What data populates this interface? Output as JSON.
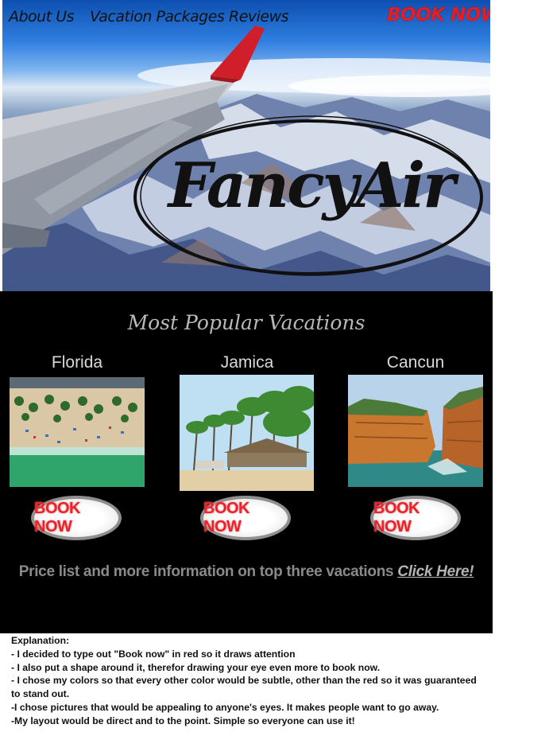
{
  "nav": {
    "about": "About Us",
    "packages": "Vacation Packages",
    "reviews": "Reviews",
    "book_now": "BOOK NOW"
  },
  "logo": {
    "text": "FancyAir"
  },
  "popular": {
    "title": "Most Popular Vacations",
    "destinations": [
      {
        "name": "Florida",
        "button": "BOOK NOW"
      },
      {
        "name": "Jamica",
        "button": "BOOK NOW"
      },
      {
        "name": "Cancun",
        "button": "BOOK NOW"
      }
    ],
    "price_text": "Price list and more information on top three vacations ",
    "click_here": "Click Here!"
  },
  "explanation": {
    "heading": "Explanation:",
    "lines": [
      "- I decided to type out \"Book now\" in red so it draws attention",
      "- I also put a shape around it, therefor drawing your eye even more to book now.",
      "- I chose my colors so that every other color would be subtle, other than the red so it was guaranteed",
      "to stand out.",
      "-I chose pictures that would be appealing to anyone's eyes.  It makes people want to go away.",
      "-My layout would be direct and to the point. Simple so everyone can use it!"
    ]
  },
  "colors": {
    "accent_red": "#e21e28",
    "section_bg": "#000000",
    "muted_text": "#8a8a8a"
  }
}
